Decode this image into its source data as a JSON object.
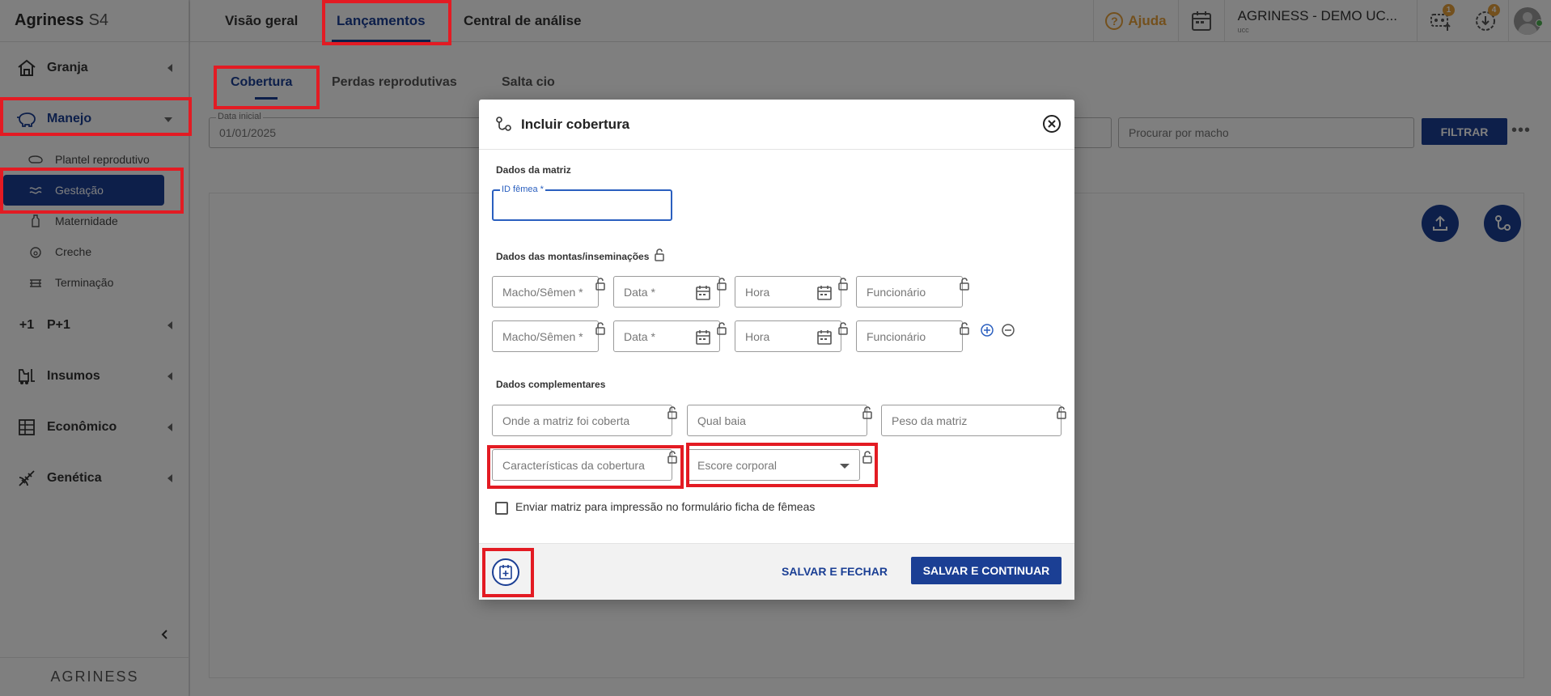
{
  "brand": {
    "name": "Agriness",
    "suffix": "S4",
    "footer": "AGRINESS"
  },
  "sidebar": {
    "groups": [
      {
        "label": "Granja",
        "icon": "barn-icon"
      },
      {
        "label": "Manejo",
        "icon": "pig-icon"
      },
      {
        "label": "P+1",
        "icon": "plus-one-icon"
      },
      {
        "label": "Insumos",
        "icon": "forklift-icon"
      },
      {
        "label": "Econômico",
        "icon": "spreadsheet-icon"
      },
      {
        "label": "Genética",
        "icon": "dna-icon"
      }
    ],
    "manejo_items": [
      {
        "label": "Plantel reprodutivo"
      },
      {
        "label": "Gestação"
      },
      {
        "label": "Maternidade"
      },
      {
        "label": "Creche"
      },
      {
        "label": "Terminação"
      }
    ]
  },
  "topbar": {
    "tabs": [
      {
        "label": "Visão geral"
      },
      {
        "label": "Lançamentos"
      },
      {
        "label": "Central de análise"
      }
    ],
    "help": "Ajuda",
    "company_name": "AGRINESS - DEMO UC...",
    "company_sub": "ucc",
    "badge_tasks": "1",
    "badge_downloads": "4"
  },
  "subtabs": [
    {
      "label": "Cobertura"
    },
    {
      "label": "Perdas reprodutivas"
    },
    {
      "label": "Salta cio"
    }
  ],
  "filters": {
    "start_label": "Data inicial",
    "start_value": "01/01/2025",
    "male_placeholder": "Procurar por macho",
    "filter_button": "FILTRAR"
  },
  "modal": {
    "title": "Incluir cobertura",
    "section_matrix": "Dados da matriz",
    "id_label": "ID fêmea *",
    "section_montas": "Dados das montas/inseminações",
    "row_fields": {
      "male": "Macho/Sêmen *",
      "date": "Data *",
      "hour": "Hora",
      "employee": "Funcionário"
    },
    "section_comp": "Dados complementares",
    "comp_fields": {
      "where": "Onde a matriz foi coberta",
      "pen": "Qual baia",
      "weight": "Peso da matriz",
      "features": "Características da cobertura",
      "score": "Escore corporal"
    },
    "checkbox_label": "Enviar matriz para impressão no formulário ficha de fêmeas",
    "save_close": "SALVAR E FECHAR",
    "save_continue": "SALVAR E CONTINUAR"
  },
  "colors": {
    "primary": "#1b3f94",
    "highlight": "#e31b23",
    "accent": "#e7a13b"
  }
}
